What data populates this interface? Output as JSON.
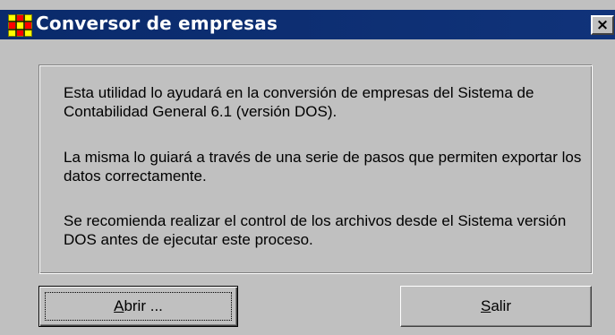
{
  "window": {
    "title": "Conversor de empresas",
    "close_glyph": "×",
    "icon": "app-grid-icon"
  },
  "content": {
    "paragraph_1": "Esta utilidad lo ayudará en la conversión de empresas del Sistema de Contabilidad General 6.1 (versión DOS).",
    "paragraph_2": "La misma lo guiará a través de una serie de pasos que permiten exportar los datos correctamente.",
    "paragraph_3": "Se recomienda realizar el control de los archivos desde el Sistema versión DOS antes de ejecutar este proceso."
  },
  "buttons": {
    "open_mnemonic": "A",
    "open_rest": "brir ...",
    "exit_mnemonic": "S",
    "exit_rest": "alir"
  },
  "colors": {
    "titlebar": "#0a2a6b",
    "face": "#c0c0c0"
  }
}
